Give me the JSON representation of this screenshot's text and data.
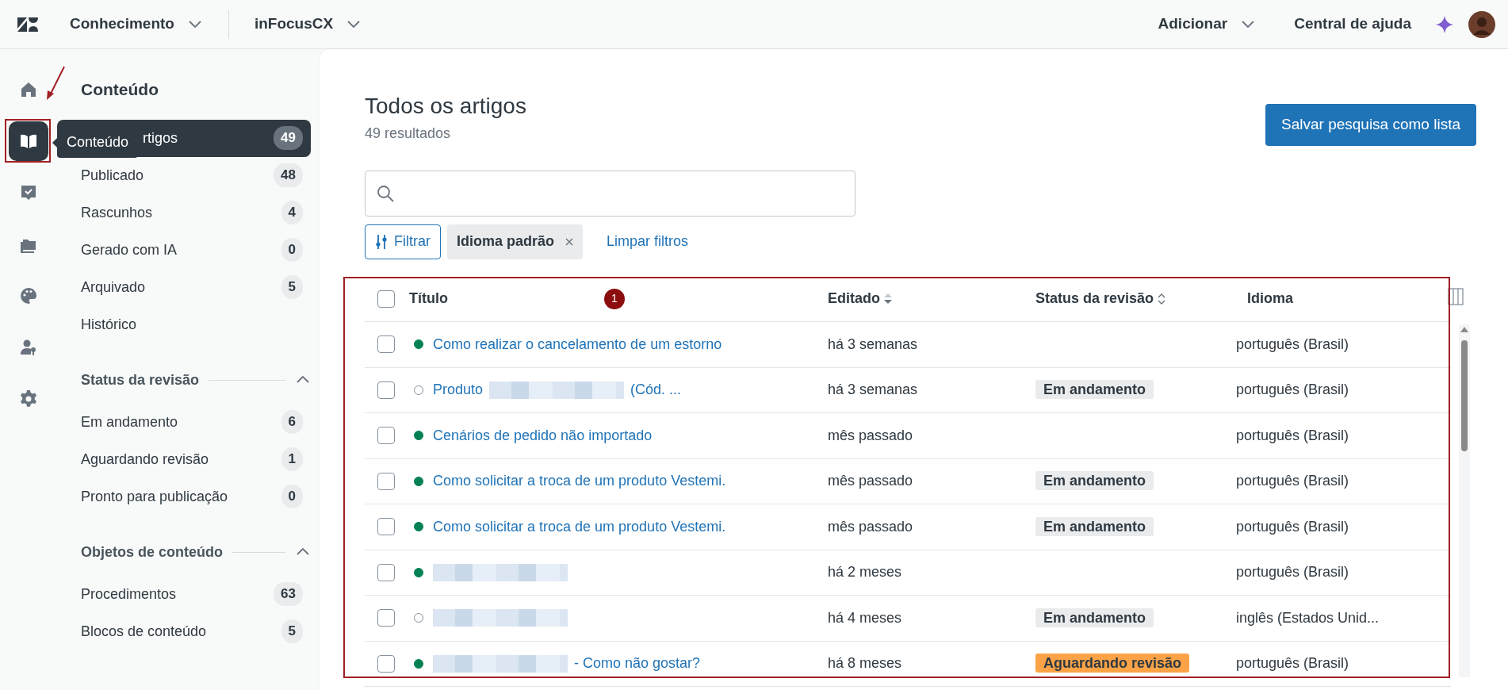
{
  "topbar": {
    "product": "Conhecimento",
    "brand": "inFocusCX",
    "add": "Adicionar",
    "help": "Central de ajuda"
  },
  "rail": [
    {
      "kind": "home",
      "selected": false
    },
    {
      "kind": "book",
      "selected": true
    },
    {
      "kind": "ticket",
      "selected": false
    },
    {
      "kind": "folder",
      "selected": false
    },
    {
      "kind": "palette",
      "selected": false
    },
    {
      "kind": "user",
      "selected": false
    },
    {
      "kind": "gear",
      "selected": false
    }
  ],
  "tooltip": "Conteúdo",
  "sidebar": {
    "title": "Conteúdo",
    "items": [
      {
        "label": "rtigos",
        "count": "49",
        "selected": true
      },
      {
        "label": "Publicado",
        "count": "48",
        "selected": false
      },
      {
        "label": "Rascunhos",
        "count": "4",
        "selected": false
      },
      {
        "label": "Gerado com IA",
        "count": "0",
        "selected": false
      },
      {
        "label": "Arquivado",
        "count": "5",
        "selected": false
      },
      {
        "label": "Histórico",
        "selected": false
      }
    ],
    "sections": [
      {
        "title": "Status da revisão",
        "expanded": true,
        "items": [
          {
            "label": "Em andamento",
            "count": "6",
            "selected": false
          },
          {
            "label": "Aguardando revisão",
            "count": "1",
            "selected": false
          },
          {
            "label": "Pronto para publicação",
            "count": "0",
            "selected": false
          }
        ]
      },
      {
        "title": "Objetos de conteúdo",
        "expanded": true,
        "items": [
          {
            "label": "Procedimentos",
            "count": "63",
            "selected": false
          },
          {
            "label": "Blocos de conteúdo",
            "count": "5",
            "selected": false
          }
        ]
      }
    ]
  },
  "main": {
    "title": "Todos os artigos",
    "subtitle": "49 resultados",
    "save_button": "Salvar pesquisa como lista",
    "filter_button": "Filtrar",
    "filter_chip": "Idioma padrão",
    "clear_filters": "Limpar filtros"
  },
  "table": {
    "select_all": {
      "checked": false
    },
    "columns": [
      {
        "label": "Título",
        "sortable": false,
        "sorted_descending": false
      },
      {
        "label": "Editado",
        "sortable": true,
        "sorted_descending": true
      },
      {
        "label": "Status da revisão",
        "sortable": true,
        "sorted_descending": false
      },
      {
        "label": "Idioma",
        "sortable": false,
        "sorted_descending": false
      }
    ],
    "rows": [
      {
        "checked": false,
        "published": true,
        "title": [
          {
            "kind": "text",
            "text": "Como realizar o cancelamento de um estorno"
          }
        ],
        "edited": "há 3 semanas",
        "language": "português (Brasil)"
      },
      {
        "checked": false,
        "published": false,
        "title": [
          {
            "kind": "text",
            "text": "Produto"
          },
          {
            "kind": "redacted"
          },
          {
            "kind": "text",
            "text": "(Cód. ..."
          }
        ],
        "edited": "há 3 semanas",
        "status": {
          "text": "Em andamento",
          "kind": "in_progress"
        },
        "language": "português (Brasil)"
      },
      {
        "checked": false,
        "published": true,
        "title": [
          {
            "kind": "text",
            "text": "Cenários de pedido não importado"
          }
        ],
        "edited": "mês passado",
        "language": "português (Brasil)"
      },
      {
        "checked": false,
        "published": true,
        "title": [
          {
            "kind": "text",
            "text": "Como solicitar a troca de um produto Vestemi."
          }
        ],
        "edited": "mês passado",
        "status": {
          "text": "Em andamento",
          "kind": "in_progress"
        },
        "language": "português (Brasil)"
      },
      {
        "checked": false,
        "published": true,
        "title": [
          {
            "kind": "text",
            "text": "Como solicitar a troca de um produto Vestemi."
          }
        ],
        "edited": "mês passado",
        "status": {
          "text": "Em andamento",
          "kind": "in_progress"
        },
        "language": "português (Brasil)"
      },
      {
        "checked": false,
        "published": true,
        "title": [
          {
            "kind": "redacted"
          }
        ],
        "edited": "há 2 meses",
        "language": "português (Brasil)"
      },
      {
        "checked": false,
        "published": false,
        "title": [
          {
            "kind": "redacted"
          }
        ],
        "edited": "há 4 meses",
        "status": {
          "text": "Em andamento",
          "kind": "in_progress"
        },
        "language": "inglês (Estados Unid..."
      },
      {
        "checked": false,
        "published": true,
        "title": [
          {
            "kind": "redacted"
          },
          {
            "kind": "text",
            "text": "- Como não gostar?"
          }
        ],
        "edited": "há 8 meses",
        "status": {
          "text": "Aguardando revisão",
          "kind": "awaiting"
        },
        "language": "português (Brasil)"
      }
    ]
  },
  "annotation": {
    "marker": "1"
  }
}
